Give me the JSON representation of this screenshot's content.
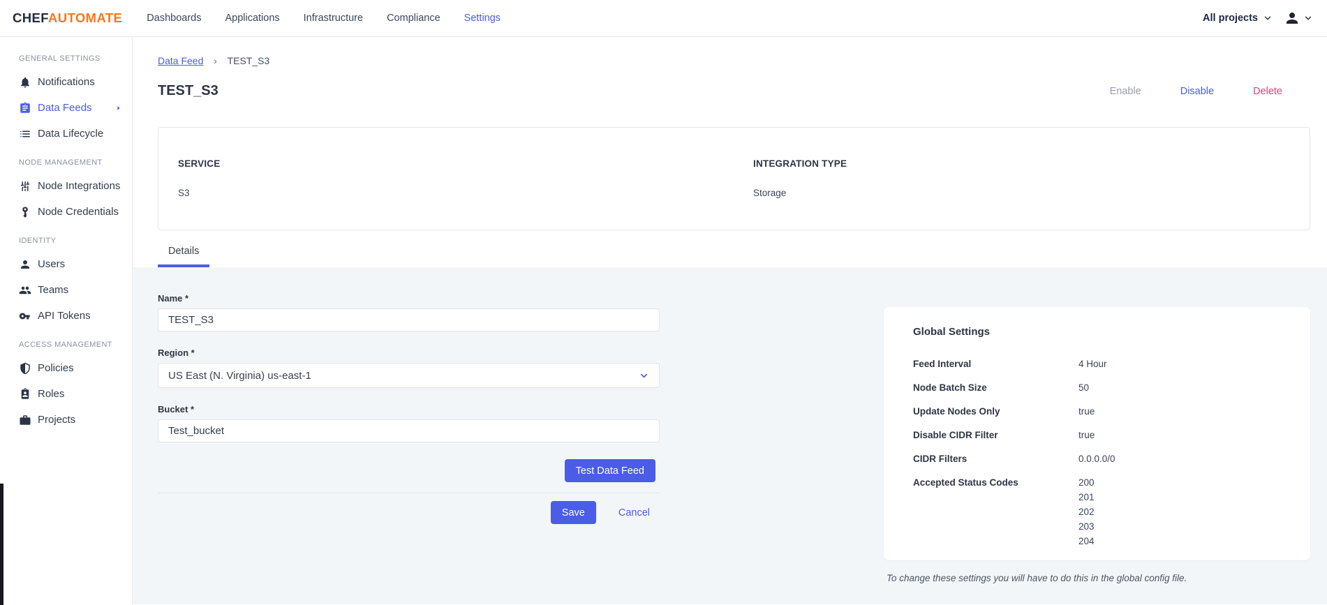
{
  "navbar": {
    "logo": {
      "part1": "CHEF",
      "part2": "AUTOMATE"
    },
    "links": [
      {
        "label": "Dashboards"
      },
      {
        "label": "Applications"
      },
      {
        "label": "Infrastructure"
      },
      {
        "label": "Compliance"
      },
      {
        "label": "Settings"
      }
    ],
    "projects_selector": "All projects"
  },
  "sidebar": {
    "sections": [
      {
        "header": "GENERAL SETTINGS",
        "items": [
          {
            "label": "Notifications",
            "icon": "bell-icon"
          },
          {
            "label": "Data Feeds",
            "icon": "clipboard-icon"
          },
          {
            "label": "Data Lifecycle",
            "icon": "list-icon"
          }
        ]
      },
      {
        "header": "NODE MANAGEMENT",
        "items": [
          {
            "label": "Node Integrations",
            "icon": "tune-icon"
          },
          {
            "label": "Node Credentials",
            "icon": "key-icon"
          }
        ]
      },
      {
        "header": "IDENTITY",
        "items": [
          {
            "label": "Users",
            "icon": "person-icon"
          },
          {
            "label": "Teams",
            "icon": "group-icon"
          },
          {
            "label": "API Tokens",
            "icon": "vpn-key-icon"
          }
        ]
      },
      {
        "header": "ACCESS MANAGEMENT",
        "items": [
          {
            "label": "Policies",
            "icon": "shield-icon"
          },
          {
            "label": "Roles",
            "icon": "badge-icon"
          },
          {
            "label": "Projects",
            "icon": "briefcase-icon"
          }
        ]
      }
    ]
  },
  "breadcrumb": {
    "link": "Data Feed",
    "separator": "›",
    "current": "TEST_S3"
  },
  "page": {
    "title": "TEST_S3",
    "actions": {
      "enable": "Enable",
      "disable": "Disable",
      "delete": "Delete"
    }
  },
  "summary": {
    "service_label": "SERVICE",
    "service_value": "S3",
    "integration_label": "INTEGRATION TYPE",
    "integration_value": "Storage"
  },
  "tabs": [
    {
      "label": "Details"
    }
  ],
  "form": {
    "name": {
      "label": "Name *",
      "value": "TEST_S3"
    },
    "region": {
      "label": "Region *",
      "value": "US East (N. Virginia) us-east-1"
    },
    "bucket": {
      "label": "Bucket *",
      "value": "Test_bucket"
    },
    "test_button": "Test Data Feed",
    "save_button": "Save",
    "cancel_link": "Cancel"
  },
  "global_settings": {
    "title": "Global Settings",
    "rows": [
      {
        "label": "Feed Interval",
        "value": "4 Hour"
      },
      {
        "label": "Node Batch Size",
        "value": "50"
      },
      {
        "label": "Update Nodes Only",
        "value": "true"
      },
      {
        "label": "Disable CIDR Filter",
        "value": "true"
      },
      {
        "label": "CIDR Filters",
        "value": "0.0.0.0/0"
      },
      {
        "label": "Accepted Status Codes",
        "values": [
          "200",
          "201",
          "202",
          "203",
          "204"
        ]
      }
    ],
    "footnote": "To change these settings you will have to do this in the global config file."
  },
  "colors": {
    "primary": "#4a5ce8",
    "brand_orange": "#f7761f",
    "delete": "#e5407c",
    "disabled": "#98a0ab"
  }
}
